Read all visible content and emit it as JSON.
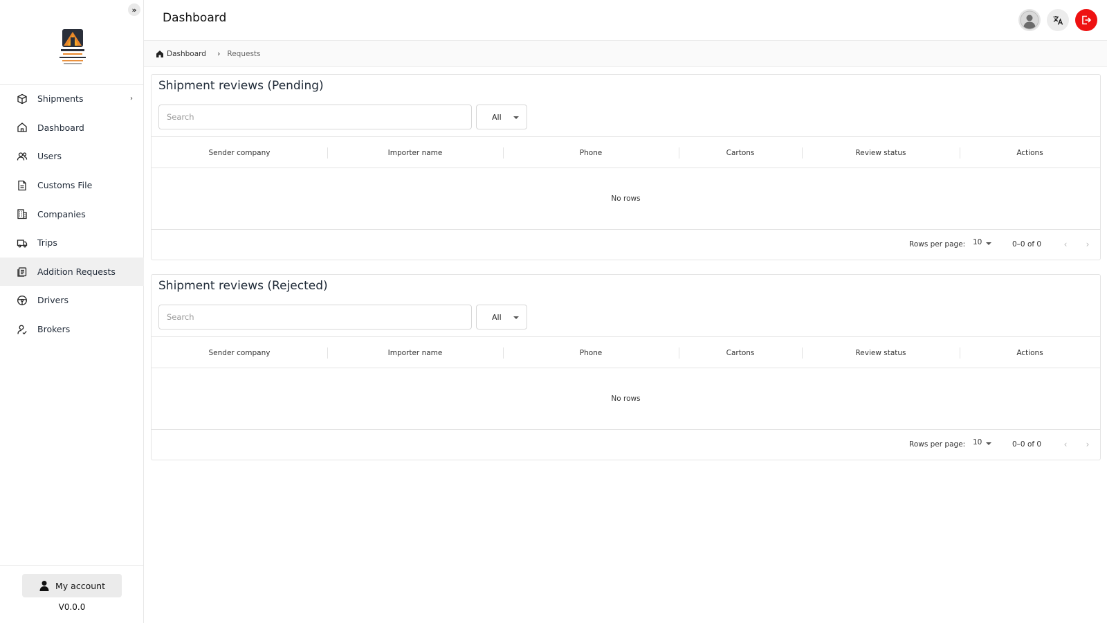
{
  "header": {
    "title": "Dashboard"
  },
  "breadcrumb": {
    "home": "Dashboard",
    "current": "Requests"
  },
  "sidebar": {
    "collapse_glyph": "»",
    "items": [
      {
        "label": "Shipments",
        "icon": "package-icon",
        "has_children": true
      },
      {
        "label": "Dashboard",
        "icon": "home-icon"
      },
      {
        "label": "Users",
        "icon": "users-icon"
      },
      {
        "label": "Customs File",
        "icon": "file-icon"
      },
      {
        "label": "Companies",
        "icon": "building-icon"
      },
      {
        "label": "Trips",
        "icon": "truck-icon"
      },
      {
        "label": "Addition Requests",
        "icon": "clipboard-icon",
        "active": true
      },
      {
        "label": "Drivers",
        "icon": "steering-wheel-icon"
      },
      {
        "label": "Brokers",
        "icon": "broker-icon"
      }
    ],
    "account_label": "My account",
    "version": "V0.0.0"
  },
  "columns": [
    "Sender company",
    "Importer name",
    "Phone",
    "Cartons",
    "Review status",
    "Actions"
  ],
  "sections": {
    "pending": {
      "title": "Shipment reviews (Pending)",
      "search_placeholder": "Search",
      "filter_value": "All",
      "empty_text": "No rows",
      "rows_per_page_label": "Rows per page:",
      "rows_per_page": "10",
      "page_range": "0–0 of 0"
    },
    "rejected": {
      "title": "Shipment reviews (Rejected)",
      "search_placeholder": "Search",
      "filter_value": "All",
      "empty_text": "No rows",
      "rows_per_page_label": "Rows per page:",
      "rows_per_page": "10",
      "page_range": "0–0 of 0"
    }
  },
  "colors": {
    "logout_button": "#ee1111",
    "active_nav_bg": "#f0f0f0",
    "logo_orange": "#e8862a",
    "logo_dark": "#2a2f3a"
  }
}
